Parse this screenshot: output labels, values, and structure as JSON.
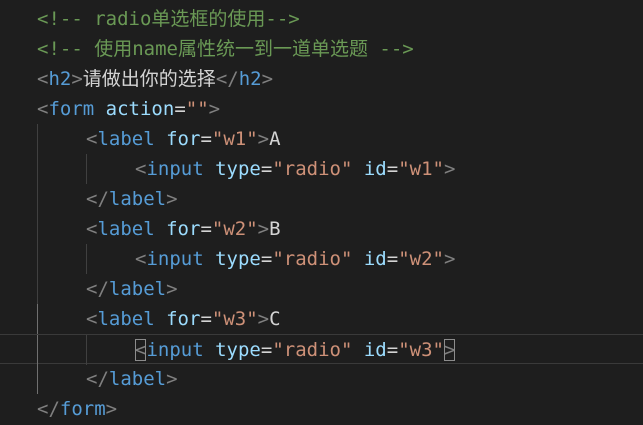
{
  "lines": [
    {
      "tokens": [
        {
          "k": "cm",
          "t": "<!-- radio单选框的使用-->"
        }
      ]
    },
    {
      "tokens": [
        {
          "k": "cm",
          "t": "<!-- 使用name属性统一到一道单选题 -->"
        }
      ]
    },
    {
      "tokens": [
        {
          "k": "br",
          "t": "<"
        },
        {
          "k": "tg",
          "t": "h2"
        },
        {
          "k": "br",
          "t": ">"
        },
        {
          "k": "txt",
          "t": "请做出你的选择"
        },
        {
          "k": "br",
          "t": "</"
        },
        {
          "k": "tg",
          "t": "h2"
        },
        {
          "k": "br",
          "t": ">"
        }
      ]
    },
    {
      "tokens": [
        {
          "k": "br",
          "t": "<"
        },
        {
          "k": "tg",
          "t": "form"
        },
        {
          "k": "txt",
          "t": " "
        },
        {
          "k": "at",
          "t": "action"
        },
        {
          "k": "op",
          "t": "="
        },
        {
          "k": "str",
          "t": "\"\""
        },
        {
          "k": "br",
          "t": ">"
        }
      ]
    },
    {
      "tokens": [
        {
          "k": "br",
          "t": "<"
        },
        {
          "k": "tg",
          "t": "label"
        },
        {
          "k": "txt",
          "t": " "
        },
        {
          "k": "at",
          "t": "for"
        },
        {
          "k": "op",
          "t": "="
        },
        {
          "k": "str",
          "t": "\"w1\""
        },
        {
          "k": "br",
          "t": ">"
        },
        {
          "k": "txt",
          "t": "A"
        }
      ]
    },
    {
      "tokens": [
        {
          "k": "br",
          "t": "<"
        },
        {
          "k": "tg",
          "t": "input"
        },
        {
          "k": "txt",
          "t": " "
        },
        {
          "k": "at",
          "t": "type"
        },
        {
          "k": "op",
          "t": "="
        },
        {
          "k": "str",
          "t": "\"radio\""
        },
        {
          "k": "txt",
          "t": " "
        },
        {
          "k": "at",
          "t": "id"
        },
        {
          "k": "op",
          "t": "="
        },
        {
          "k": "str",
          "t": "\"w1\""
        },
        {
          "k": "br",
          "t": ">"
        }
      ]
    },
    {
      "tokens": [
        {
          "k": "br",
          "t": "</"
        },
        {
          "k": "tg",
          "t": "label"
        },
        {
          "k": "br",
          "t": ">"
        }
      ]
    },
    {
      "tokens": [
        {
          "k": "br",
          "t": "<"
        },
        {
          "k": "tg",
          "t": "label"
        },
        {
          "k": "txt",
          "t": " "
        },
        {
          "k": "at",
          "t": "for"
        },
        {
          "k": "op",
          "t": "="
        },
        {
          "k": "str",
          "t": "\"w2\""
        },
        {
          "k": "br",
          "t": ">"
        },
        {
          "k": "txt",
          "t": "B"
        }
      ]
    },
    {
      "tokens": [
        {
          "k": "br",
          "t": "<"
        },
        {
          "k": "tg",
          "t": "input"
        },
        {
          "k": "txt",
          "t": " "
        },
        {
          "k": "at",
          "t": "type"
        },
        {
          "k": "op",
          "t": "="
        },
        {
          "k": "str",
          "t": "\"radio\""
        },
        {
          "k": "txt",
          "t": " "
        },
        {
          "k": "at",
          "t": "id"
        },
        {
          "k": "op",
          "t": "="
        },
        {
          "k": "str",
          "t": "\"w2\""
        },
        {
          "k": "br",
          "t": ">"
        }
      ]
    },
    {
      "tokens": [
        {
          "k": "br",
          "t": "</"
        },
        {
          "k": "tg",
          "t": "label"
        },
        {
          "k": "br",
          "t": ">"
        }
      ]
    },
    {
      "tokens": [
        {
          "k": "br",
          "t": "<"
        },
        {
          "k": "tg",
          "t": "label"
        },
        {
          "k": "txt",
          "t": " "
        },
        {
          "k": "at",
          "t": "for"
        },
        {
          "k": "op",
          "t": "="
        },
        {
          "k": "str",
          "t": "\"w3\""
        },
        {
          "k": "br",
          "t": ">"
        },
        {
          "k": "txt",
          "t": "C"
        }
      ]
    },
    {
      "tokens": [
        {
          "k": "br hl",
          "t": "<"
        },
        {
          "k": "tg",
          "t": "input"
        },
        {
          "k": "txt",
          "t": " "
        },
        {
          "k": "at",
          "t": "type"
        },
        {
          "k": "op",
          "t": "="
        },
        {
          "k": "str",
          "t": "\"radio\""
        },
        {
          "k": "txt",
          "t": " "
        },
        {
          "k": "at",
          "t": "id"
        },
        {
          "k": "op",
          "t": "="
        },
        {
          "k": "str",
          "t": "\"w3\""
        },
        {
          "k": "br hl",
          "t": ">"
        }
      ]
    },
    {
      "tokens": [
        {
          "k": "br",
          "t": "</"
        },
        {
          "k": "tg",
          "t": "label"
        },
        {
          "k": "br",
          "t": ">"
        }
      ]
    },
    {
      "tokens": [
        {
          "k": "br",
          "t": "</"
        },
        {
          "k": "tg",
          "t": "form"
        },
        {
          "k": "br",
          "t": ">"
        }
      ]
    }
  ],
  "colors": {
    "background": "#1e1e1e",
    "comment": "#6a9955",
    "bracket": "#808080",
    "tag": "#569cd6",
    "attribute": "#9cdcfe",
    "string": "#ce9178",
    "text": "#d4d4d4"
  }
}
